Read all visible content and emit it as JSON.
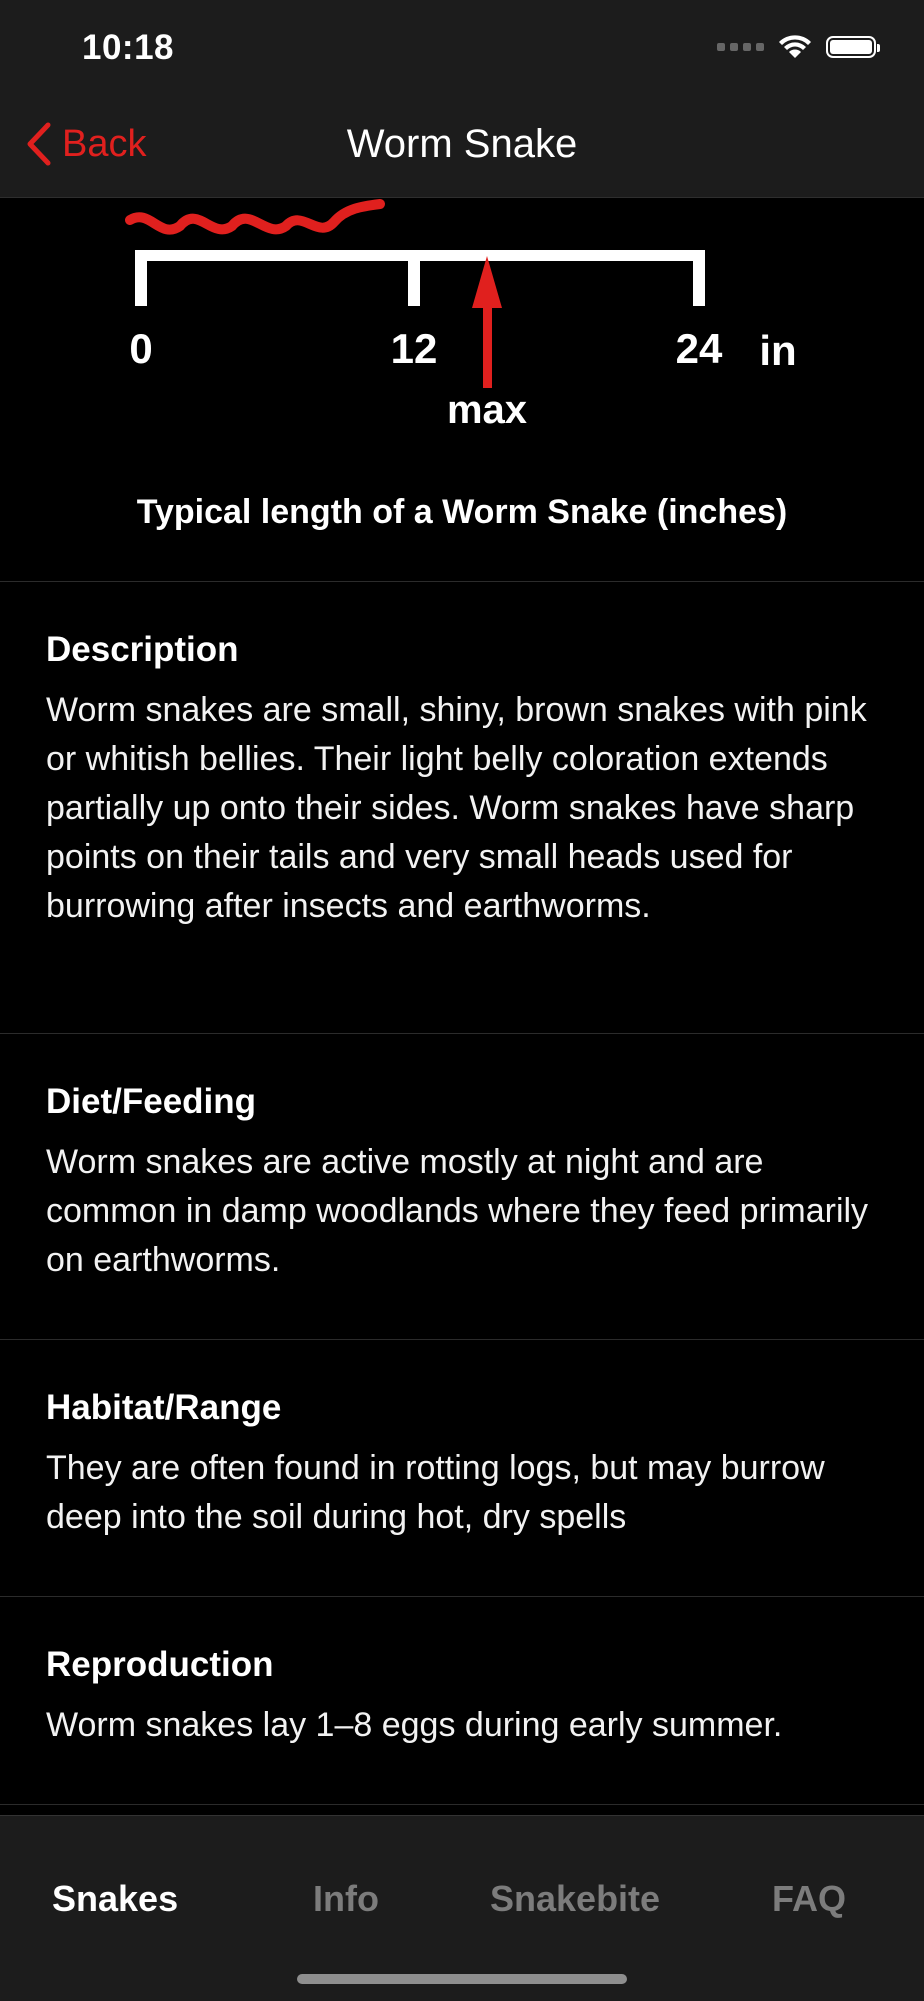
{
  "status_bar": {
    "time": "10:18"
  },
  "nav": {
    "back_label": "Back",
    "title": "Worm Snake"
  },
  "figure": {
    "tick_labels": [
      "0",
      "12",
      "24"
    ],
    "unit": "in",
    "marker_label": "max",
    "caption": "Typical length of a Worm Snake (inches)",
    "accent_color": "#e0201e"
  },
  "sections": [
    {
      "title": "Description",
      "body": "Worm snakes are small, shiny, brown snakes with pink or whitish bellies. Their light belly coloration extends partially up onto their sides. Worm snakes have sharp points on their tails and very small heads used for burrowing after insects and earthworms."
    },
    {
      "title": "Diet/Feeding",
      "body": "Worm snakes are active mostly at night and are common in damp woodlands where they feed primarily on earthworms."
    },
    {
      "title": "Habitat/Range",
      "body": "They are often found in rotting logs, but may burrow deep into the soil during hot, dry spells"
    },
    {
      "title": "Reproduction",
      "body": "Worm snakes lay 1–8 eggs during early summer."
    }
  ],
  "tab_bar": {
    "tabs": [
      {
        "label": "Snakes",
        "active": true
      },
      {
        "label": "Info",
        "active": false
      },
      {
        "label": "Snakebite",
        "active": false
      },
      {
        "label": "FAQ",
        "active": false
      }
    ]
  }
}
